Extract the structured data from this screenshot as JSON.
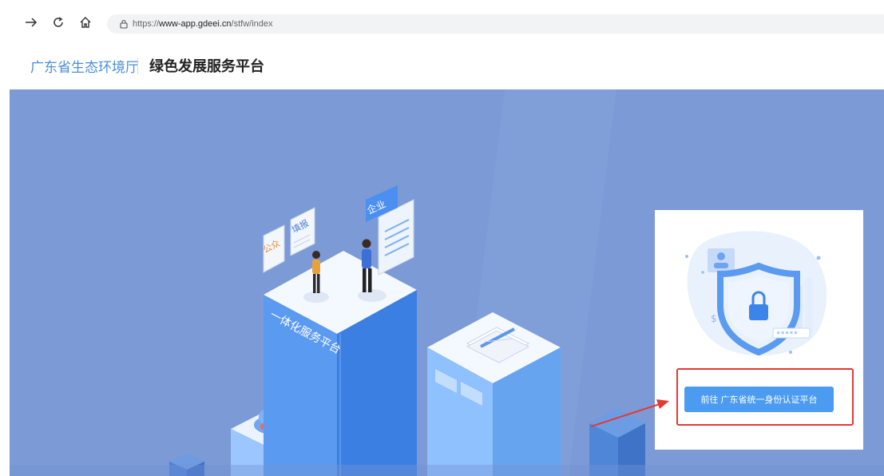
{
  "browser": {
    "url_prefix": "https://",
    "url_host": "www-app.gdeei.cn",
    "url_path": "/stfw/index"
  },
  "header": {
    "org_name": "广东省生态环境厅",
    "platform_name": "绿色发展服务平台"
  },
  "hero": {
    "tower_label": "一体化服务平台",
    "card_labels": [
      "公众",
      "填报",
      "企业"
    ]
  },
  "login_card": {
    "button_label": "前往 广东省统一身份认证平台"
  },
  "colors": {
    "hero_bg": "#7b9ad6",
    "accent": "#4b9bf0",
    "org_text": "#4a8fd6",
    "highlight": "#e53935"
  }
}
